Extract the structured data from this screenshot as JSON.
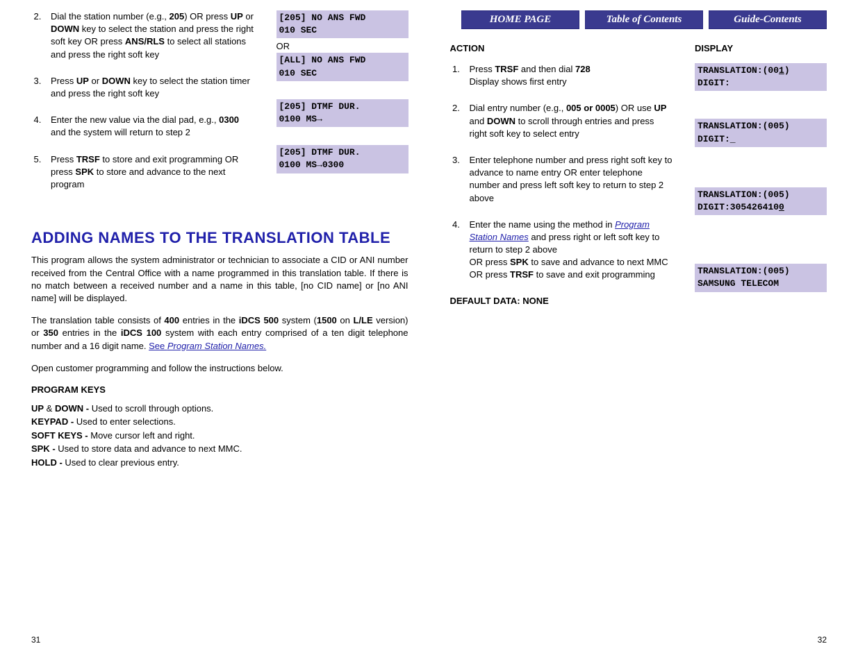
{
  "nav": {
    "home": "HOME PAGE",
    "toc": "Table of Contents",
    "guide": "Guide-Contents"
  },
  "left": {
    "steps": {
      "s2_pre": "Dial the station number (e.g., ",
      "s2_b1": "205",
      "s2_mid1": ") OR press ",
      "s2_b2": "UP",
      "s2_mid2": " or ",
      "s2_b3": "DOWN",
      "s2_mid3": " key to select the station and press the right soft key OR press ",
      "s2_b4": "ANS/RLS",
      "s2_end": " to select all stations and press the right soft key",
      "s3_pre": "Press ",
      "s3_b1": "UP",
      "s3_mid": " or ",
      "s3_b2": "DOWN",
      "s3_end": " key to select the station timer and press the right soft key",
      "s4_pre": "Enter the new value via the dial pad, e.g., ",
      "s4_b1": "0300",
      "s4_end": " and the system will return to step 2",
      "s5_pre": "Press ",
      "s5_b1": "TRSF",
      "s5_mid": " to store and exit programming OR press ",
      "s5_b2": "SPK",
      "s5_end": " to store and advance to the next program"
    },
    "displays": {
      "d1": "[205] NO ANS FWD\n010 SEC",
      "or": "OR",
      "d2": "[ALL] NO ANS FWD\n010 SEC",
      "d3": "[205] DTMF DUR.\n0100 MS→",
      "d4": "[205] DTMF DUR.\n0100 MS→0300"
    },
    "title": "ADDING NAMES TO THE TRANSLATION TABLE",
    "para1": "This program allows the system administrator or technician to associate a CID or ANI number received from the Central Office with a name programmed in this translation table. If there is no match between a received number and a name in this table, [no CID name] or [no ANI name] will be displayed.",
    "para2_pre": "The translation table consists of ",
    "para2_b1": "400",
    "para2_m1": " entries in the ",
    "para2_b2": "iDCS 500",
    "para2_m2": " system (",
    "para2_b3": "1500",
    "para2_m3": " on ",
    "para2_b4": "L/LE",
    "para2_m4": " version) or ",
    "para2_b5": "350",
    "para2_m5": " entries in the ",
    "para2_b6": "iDCS 100",
    "para2_m6": " system with each entry comprised of a ten digit telephone number and a 16 digit name. ",
    "para2_link_pre": "See ",
    "para2_link": "Program Station Names.",
    "para3": "Open customer programming and follow the instructions below.",
    "pk_title": "PROGRAM KEYS",
    "pk1_b": "UP",
    "pk1_amp": " & ",
    "pk1_b2": "DOWN - ",
    "pk1_t": "Used to scroll through options.",
    "pk2_b": "KEYPAD - ",
    "pk2_t": "Used to enter selections.",
    "pk3_b": "SOFT KEYS - ",
    "pk3_t": "Move cursor left and right.",
    "pk4_b": "SPK - ",
    "pk4_t": "Used to store data and advance to next MMC.",
    "pk5_b": "HOLD - ",
    "pk5_t": "Used to clear previous entry.",
    "pagenum": "31"
  },
  "right": {
    "action_header": "ACTION",
    "display_header": "DISPLAY",
    "steps": {
      "s1_pre": "Press ",
      "s1_b1": "TRSF",
      "s1_mid": " and then dial ",
      "s1_b2": "728",
      "s1_br": "Display shows first entry",
      "s2_pre": "Dial entry number (e.g., ",
      "s2_b1": "005 or 0005",
      "s2_mid1": ") OR use ",
      "s2_b2": "UP",
      "s2_mid2": " and ",
      "s2_b3": "DOWN",
      "s2_end": " to scroll through entries and press right soft key to select entry",
      "s3": "Enter telephone number and press right soft key to advance to name entry OR enter telephone number and press left soft key to return to step 2 above",
      "s4_pre": "Enter the name using the method in ",
      "s4_link": "Program Station Names",
      "s4_mid": " and press right or left soft key to return to step 2 above",
      "s4_br1": "OR press ",
      "s4_b1": "SPK",
      "s4_mid2": " to save and advance to next MMC OR press ",
      "s4_b2": "TRSF",
      "s4_end": " to save and exit programming"
    },
    "displays": {
      "d1a": "TRANSLATION:(00",
      "d1a_u": "1",
      "d1a_end": ")",
      "d1b": "DIGIT:",
      "d2a": "TRANSLATION:(005)",
      "d2b": "DIGIT:_",
      "d3a": "TRANSLATION:(005)",
      "d3b": "DIGIT:305426410",
      "d3b_u": "0",
      "d4a": "TRANSLATION:(005)",
      "d4b": "SAMSUNG TELECOM"
    },
    "default_data": "DEFAULT DATA: NONE",
    "pagenum": "32"
  }
}
